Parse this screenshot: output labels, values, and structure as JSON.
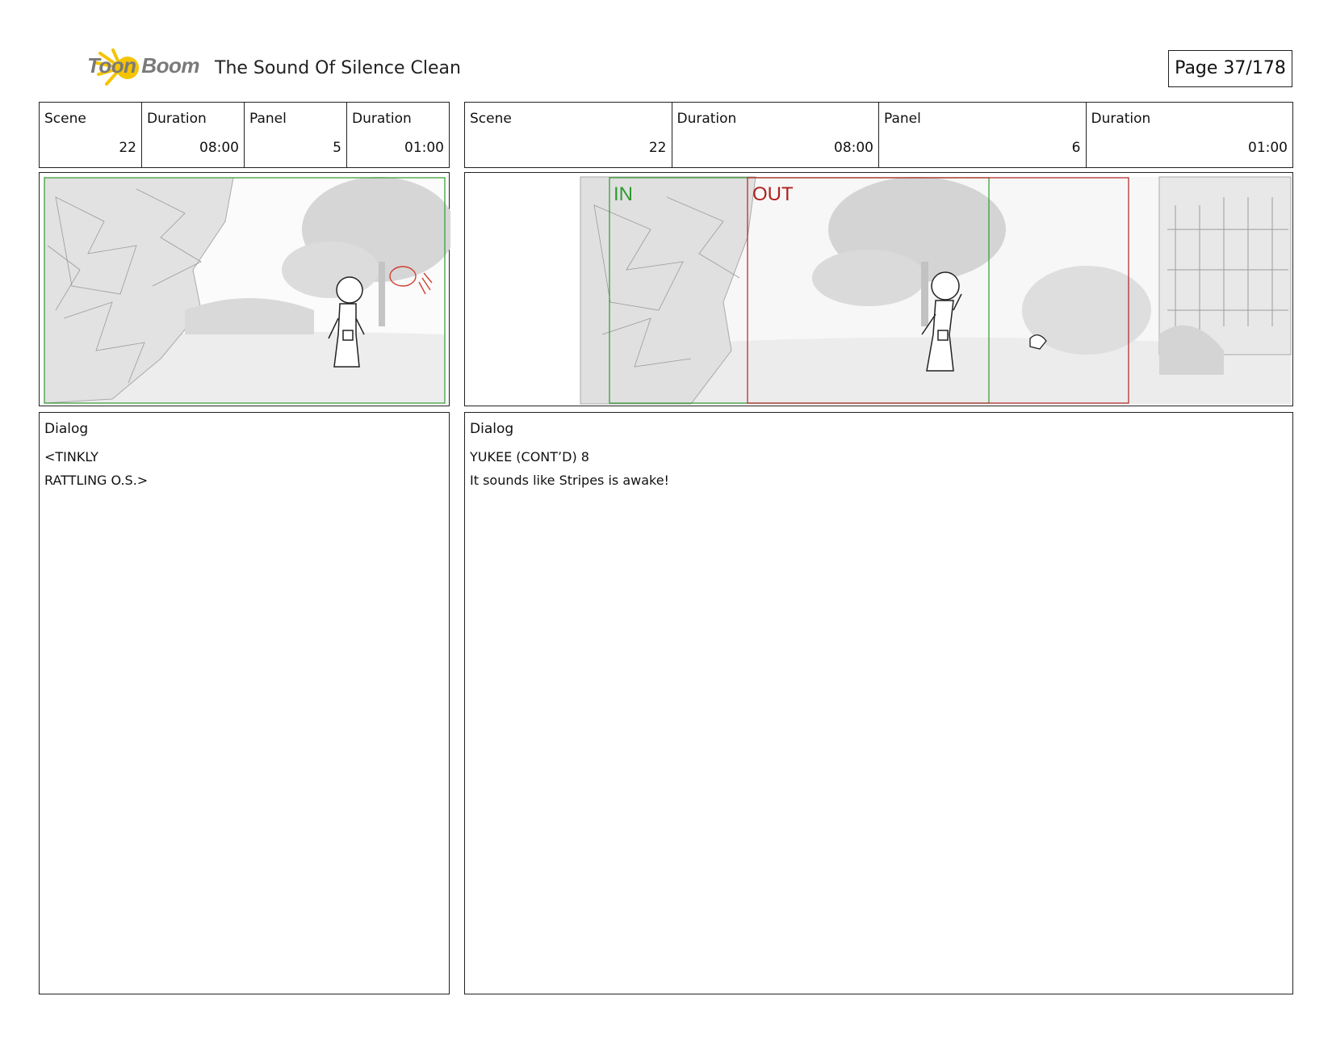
{
  "header": {
    "brand": "Toon Boom",
    "title": "The Sound Of Silence  Clean",
    "page": "Page  37/178"
  },
  "panels": [
    {
      "info": [
        {
          "label": "Scene",
          "value": "22"
        },
        {
          "label": "Duration",
          "value": "08:00"
        },
        {
          "label": "Panel",
          "value": "5"
        },
        {
          "label": "Duration",
          "value": "01:00"
        }
      ],
      "dialog": {
        "title": "Dialog",
        "lines": [
          "<TINKLY",
          "RATTLING O.S.>"
        ]
      }
    },
    {
      "info": [
        {
          "label": "Scene",
          "value": "22"
        },
        {
          "label": "Duration",
          "value": "08:00"
        },
        {
          "label": "Panel",
          "value": "6"
        },
        {
          "label": "Duration",
          "value": "01:00"
        }
      ],
      "camera_labels": {
        "in": "IN",
        "out": "OUT"
      },
      "dialog": {
        "title": "Dialog",
        "lines": [
          "YUKEE (CONT’D) 8",
          "It sounds like Stripes is awake!"
        ]
      }
    }
  ],
  "colors": {
    "in_frame": "#2e9a2e",
    "out_frame": "#b02020",
    "logo": "#f5c400"
  }
}
